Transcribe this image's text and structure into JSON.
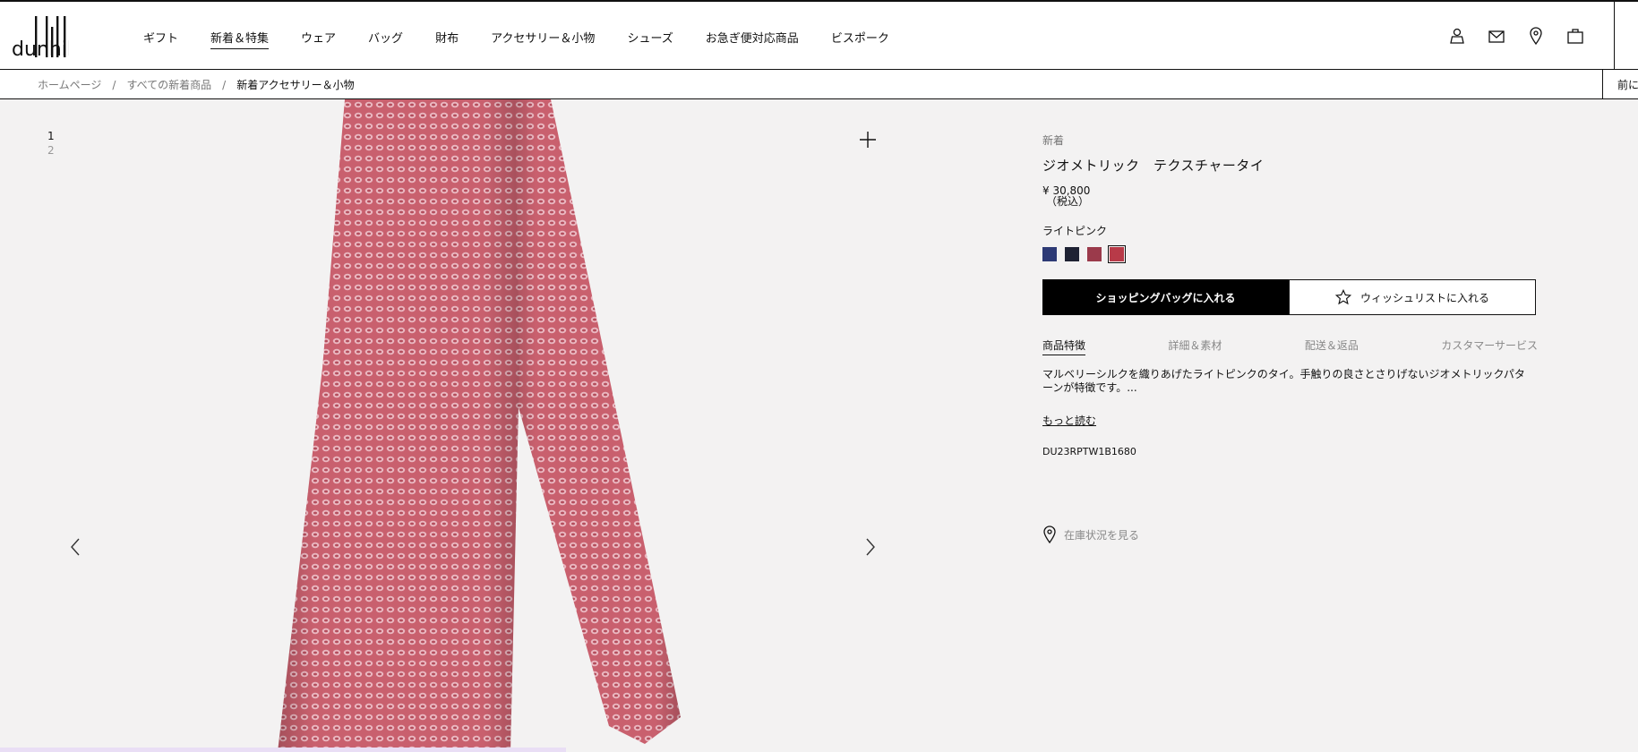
{
  "header": {
    "logo_text": "dunhill",
    "nav": [
      "ギフト",
      "新着＆特集",
      "ウェア",
      "バッグ",
      "財布",
      "アクセサリー＆小物",
      "シューズ",
      "お急ぎ便対応商品",
      "ビスポーク"
    ],
    "icons": [
      "account-icon",
      "mail-icon",
      "store-location-icon",
      "shopping-bag-icon"
    ]
  },
  "breadcrumb": {
    "items": [
      "ホームページ",
      "すべての新着商品"
    ],
    "current": "新着アクセサリー＆小物",
    "separator": "/",
    "right_text": "前に"
  },
  "gallery": {
    "pages": [
      "1",
      "2"
    ],
    "current_page": 1,
    "image_subject": "pink geometric textured silk tie"
  },
  "product": {
    "badge": "新着",
    "title": "ジオメトリック　テクスチャータイ",
    "price": "¥ 30,800",
    "tax_note": "（税込）",
    "color_name": "ライトピンク",
    "swatches": [
      {
        "name": "navy-blue",
        "color": "#2d3a75"
      },
      {
        "name": "dark-navy",
        "color": "#1e2233"
      },
      {
        "name": "burgundy",
        "color": "#9b3a4b"
      },
      {
        "name": "red",
        "color": "#b83a48"
      }
    ],
    "selected_swatch": 3,
    "add_to_bag_label": "ショッピングバッグに入れる",
    "wishlist_label": "ウィッシュリストに入れる",
    "tabs": [
      "商品特徴",
      "詳細＆素材",
      "配送＆返品",
      "カスタマーサービス"
    ],
    "active_tab": 0,
    "description": "マルベリーシルクを織りあげたライトピンクのタイ。手触りの良さとさりげないジオメトリックパターンが特徴です。...",
    "read_more_label": "もっと読む",
    "sku": "DU23RPTW1B1680",
    "stock_label": "在庫状況を見る"
  }
}
